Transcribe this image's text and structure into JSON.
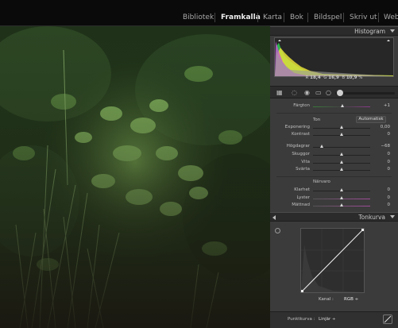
{
  "modules": [
    {
      "label": "Bibliotek"
    },
    {
      "label": "Framkalla",
      "active": true
    },
    {
      "label": "Karta"
    },
    {
      "label": "Bok"
    },
    {
      "label": "Bildspel"
    },
    {
      "label": "Skriv ut"
    },
    {
      "label": "Web"
    }
  ],
  "histogram": {
    "title": "Histogram",
    "readout": {
      "r_label": "R",
      "r_value": "18,4",
      "g_label": "G",
      "g_value": "16,9",
      "b_label": "B",
      "b_value": "10,9",
      "unit": "%"
    }
  },
  "basic": {
    "fargton": {
      "label": "Färgton",
      "value": "+1",
      "knob": 0.52
    },
    "ton_label": "Ton",
    "auto_label": "Automatisk",
    "exponering": {
      "label": "Exponering",
      "value": "0,00",
      "knob": 0.5
    },
    "kontrast": {
      "label": "Kontrast",
      "value": "0",
      "knob": 0.5
    },
    "hogdagrar": {
      "label": "Högdagrar",
      "value": "−68",
      "knob": 0.16
    },
    "skuggor": {
      "label": "Skuggor",
      "value": "0",
      "knob": 0.5
    },
    "vita": {
      "label": "Vita",
      "value": "0",
      "knob": 0.5
    },
    "svarta": {
      "label": "Svärta",
      "value": "0",
      "knob": 0.5
    },
    "narvaro_label": "Närvaro",
    "klarhet": {
      "label": "Klarhet",
      "value": "0",
      "knob": 0.5
    },
    "lyster": {
      "label": "Lyster",
      "value": "0",
      "knob": 0.5
    },
    "mattnad": {
      "label": "Mättnad",
      "value": "0",
      "knob": 0.5
    }
  },
  "tonkurva": {
    "title": "Tonkurva",
    "kanal_label": "Kanal :",
    "kanal_value": "RGB ÷",
    "punktkurva_label": "Punktkurva :",
    "punktkurva_value": "Linjär ÷"
  }
}
